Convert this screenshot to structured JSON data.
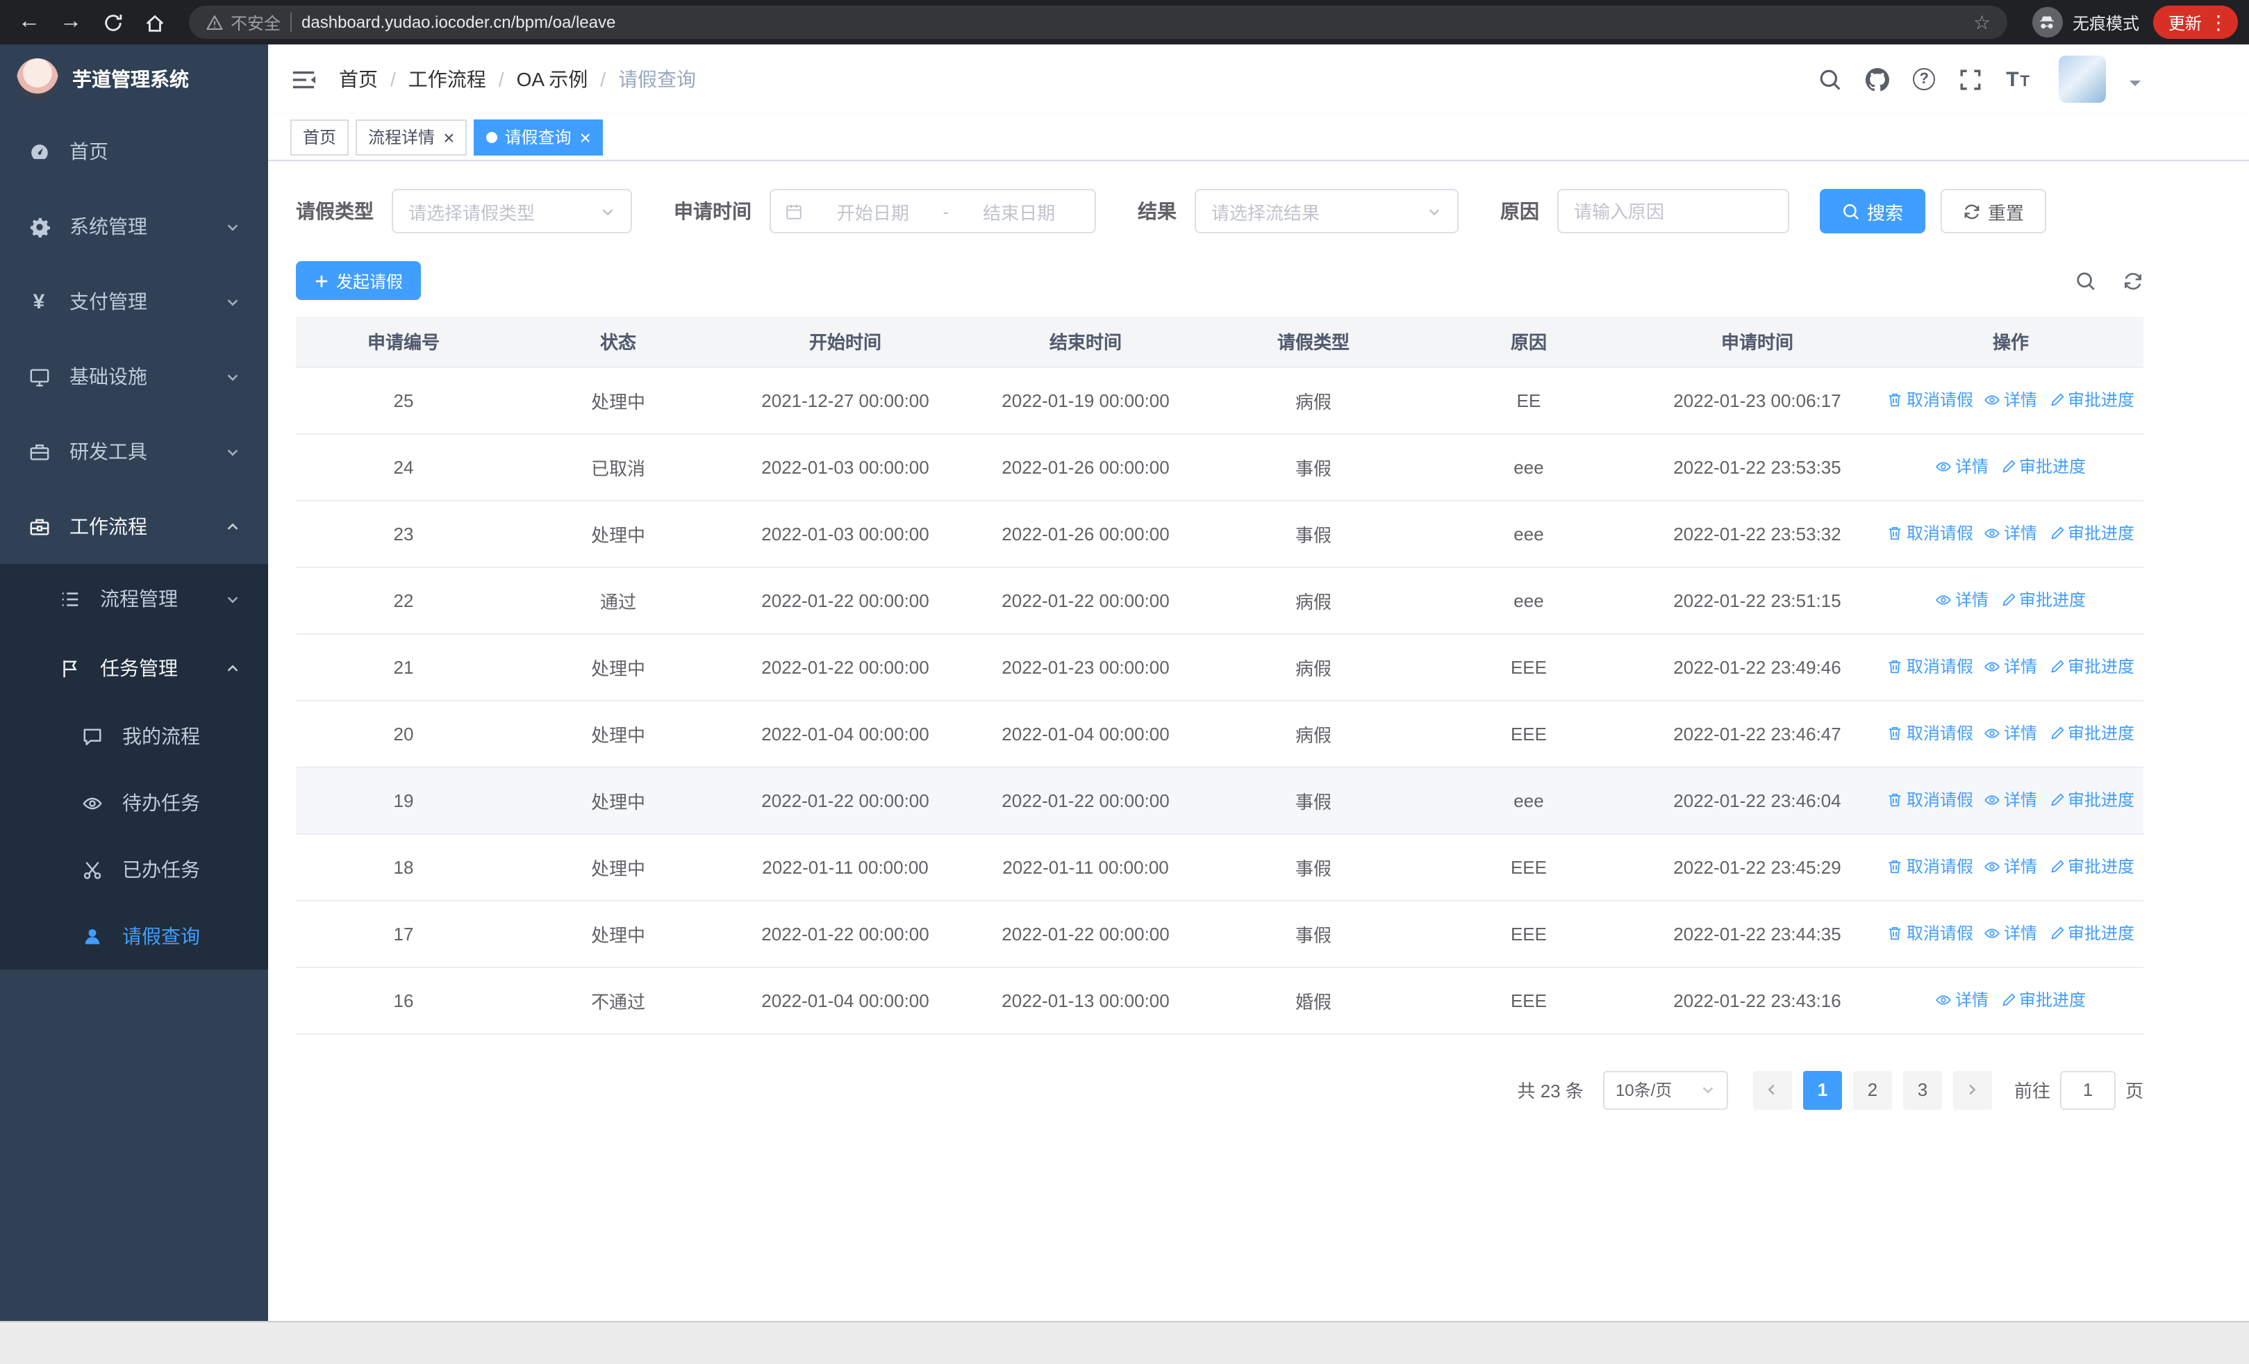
{
  "browser": {
    "security_label": "不安全",
    "url": "dashboard.yudao.iocoder.cn/bpm/oa/leave",
    "incognito_label": "无痕模式",
    "update_label": "更新"
  },
  "sidebar": {
    "logo_title": "芋道管理系统",
    "items": [
      {
        "key": "home",
        "label": "首页",
        "icon": "dashboard-icon",
        "level": 0
      },
      {
        "key": "system-management",
        "label": "系统管理",
        "icon": "gear-icon",
        "level": 0,
        "arrow": "down"
      },
      {
        "key": "payment-management",
        "label": "支付管理",
        "icon": "yen-icon",
        "level": 0,
        "arrow": "down"
      },
      {
        "key": "infrastructure",
        "label": "基础设施",
        "icon": "monitor-icon",
        "level": 0,
        "arrow": "down"
      },
      {
        "key": "dev-tools",
        "label": "研发工具",
        "icon": "toolbox-icon",
        "level": 0,
        "arrow": "down"
      },
      {
        "key": "workflow",
        "label": "工作流程",
        "icon": "briefcase-icon",
        "level": 0,
        "arrow": "up",
        "open": true
      },
      {
        "key": "process-management",
        "label": "流程管理",
        "icon": "list-icon",
        "level": 1,
        "arrow": "down"
      },
      {
        "key": "task-management",
        "label": "任务管理",
        "icon": "flag-icon",
        "level": 1,
        "arrow": "up",
        "open": true
      },
      {
        "key": "my-process",
        "label": "我的流程",
        "icon": "chat-icon",
        "level": 2
      },
      {
        "key": "todo-task",
        "label": "待办任务",
        "icon": "eye-icon",
        "level": 2
      },
      {
        "key": "done-task",
        "label": "已办任务",
        "icon": "scissors-icon",
        "level": 2
      },
      {
        "key": "leave-query",
        "label": "请假查询",
        "icon": "user-icon",
        "level": 2,
        "active": true
      }
    ]
  },
  "header": {
    "breadcrumb": [
      "首页",
      "工作流程",
      "OA 示例",
      "请假查询"
    ],
    "separator": "/"
  },
  "tabs": [
    {
      "label": "首页",
      "closable": false,
      "active": false
    },
    {
      "label": "流程详情",
      "closable": true,
      "active": false
    },
    {
      "label": "请假查询",
      "closable": true,
      "active": true
    }
  ],
  "filters": {
    "leave_type_label": "请假类型",
    "leave_type_placeholder": "请选择请假类型",
    "apply_time_label": "申请时间",
    "start_date_placeholder": "开始日期",
    "range_separator": "-",
    "end_date_placeholder": "结束日期",
    "result_label": "结果",
    "result_placeholder": "请选择流结果",
    "reason_label": "原因",
    "reason_placeholder": "请输入原因",
    "search_label": "搜索",
    "reset_label": "重置"
  },
  "toolbar": {
    "create_label": "发起请假"
  },
  "table": {
    "columns": [
      "申请编号",
      "状态",
      "开始时间",
      "结束时间",
      "请假类型",
      "原因",
      "申请时间",
      "操作"
    ],
    "action_defs": {
      "cancel": {
        "label": "取消请假",
        "icon": "delete-icon"
      },
      "detail": {
        "label": "详情",
        "icon": "view-icon"
      },
      "progress": {
        "label": "审批进度",
        "icon": "edit-icon"
      }
    },
    "rows": [
      {
        "id": "25",
        "status": "处理中",
        "start": "2021-12-27 00:00:00",
        "end": "2022-01-19 00:00:00",
        "type": "病假",
        "reason": "EE",
        "apply_time": "2022-01-23 00:06:17",
        "actions": [
          "cancel",
          "detail",
          "progress"
        ]
      },
      {
        "id": "24",
        "status": "已取消",
        "start": "2022-01-03 00:00:00",
        "end": "2022-01-26 00:00:00",
        "type": "事假",
        "reason": "eee",
        "apply_time": "2022-01-22 23:53:35",
        "actions": [
          "detail",
          "progress"
        ]
      },
      {
        "id": "23",
        "status": "处理中",
        "start": "2022-01-03 00:00:00",
        "end": "2022-01-26 00:00:00",
        "type": "事假",
        "reason": "eee",
        "apply_time": "2022-01-22 23:53:32",
        "actions": [
          "cancel",
          "detail",
          "progress"
        ]
      },
      {
        "id": "22",
        "status": "通过",
        "start": "2022-01-22 00:00:00",
        "end": "2022-01-22 00:00:00",
        "type": "病假",
        "reason": "eee",
        "apply_time": "2022-01-22 23:51:15",
        "actions": [
          "detail",
          "progress"
        ]
      },
      {
        "id": "21",
        "status": "处理中",
        "start": "2022-01-22 00:00:00",
        "end": "2022-01-23 00:00:00",
        "type": "病假",
        "reason": "EEE",
        "apply_time": "2022-01-22 23:49:46",
        "actions": [
          "cancel",
          "detail",
          "progress"
        ]
      },
      {
        "id": "20",
        "status": "处理中",
        "start": "2022-01-04 00:00:00",
        "end": "2022-01-04 00:00:00",
        "type": "病假",
        "reason": "EEE",
        "apply_time": "2022-01-22 23:46:47",
        "actions": [
          "cancel",
          "detail",
          "progress"
        ]
      },
      {
        "id": "19",
        "status": "处理中",
        "start": "2022-01-22 00:00:00",
        "end": "2022-01-22 00:00:00",
        "type": "事假",
        "reason": "eee",
        "apply_time": "2022-01-22 23:46:04",
        "actions": [
          "cancel",
          "detail",
          "progress"
        ],
        "highlighted": true
      },
      {
        "id": "18",
        "status": "处理中",
        "start": "2022-01-11 00:00:00",
        "end": "2022-01-11 00:00:00",
        "type": "事假",
        "reason": "EEE",
        "apply_time": "2022-01-22 23:45:29",
        "actions": [
          "cancel",
          "detail",
          "progress"
        ]
      },
      {
        "id": "17",
        "status": "处理中",
        "start": "2022-01-22 00:00:00",
        "end": "2022-01-22 00:00:00",
        "type": "事假",
        "reason": "EEE",
        "apply_time": "2022-01-22 23:44:35",
        "actions": [
          "cancel",
          "detail",
          "progress"
        ]
      },
      {
        "id": "16",
        "status": "不通过",
        "start": "2022-01-04 00:00:00",
        "end": "2022-01-13 00:00:00",
        "type": "婚假",
        "reason": "EEE",
        "apply_time": "2022-01-22 23:43:16",
        "actions": [
          "detail",
          "progress"
        ]
      }
    ]
  },
  "pagination": {
    "total_text": "共 23 条",
    "page_size": "10条/页",
    "pages": [
      "1",
      "2",
      "3"
    ],
    "active_page": "1",
    "goto_prefix": "前往",
    "goto_value": "1",
    "goto_suffix": "页"
  }
}
